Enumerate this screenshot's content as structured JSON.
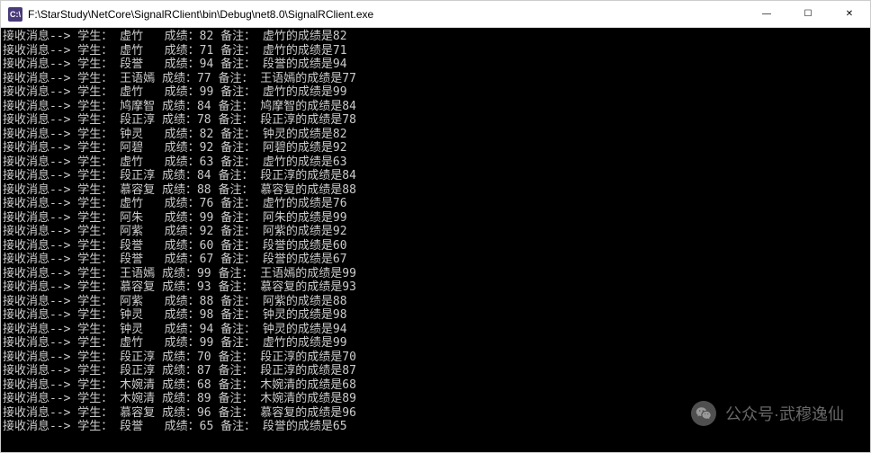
{
  "titlebar": {
    "icon_label": "C:\\",
    "title": "F:\\StarStudy\\NetCore\\SignalRClient\\bin\\Debug\\net8.0\\SignalRClient.exe",
    "minimize": "—",
    "maximize": "☐",
    "close": "✕"
  },
  "console": {
    "prefix": "接收消息--> 学生：",
    "score_label": "成绩：",
    "remark_label": "备注：",
    "remark_suffix": "的成绩是",
    "rows": [
      {
        "name": "虚竹",
        "score": 82
      },
      {
        "name": "虚竹",
        "score": 71
      },
      {
        "name": "段誉",
        "score": 94
      },
      {
        "name": "王语嫣",
        "score": 77
      },
      {
        "name": "虚竹",
        "score": 99
      },
      {
        "name": "鸠摩智",
        "score": 84
      },
      {
        "name": "段正淳",
        "score": 78
      },
      {
        "name": "钟灵",
        "score": 82
      },
      {
        "name": "阿碧",
        "score": 92
      },
      {
        "name": "虚竹",
        "score": 63
      },
      {
        "name": "段正淳",
        "score": 84
      },
      {
        "name": "慕容复",
        "score": 88
      },
      {
        "name": "虚竹",
        "score": 76
      },
      {
        "name": "阿朱",
        "score": 99
      },
      {
        "name": "阿紫",
        "score": 92
      },
      {
        "name": "段誉",
        "score": 60
      },
      {
        "name": "段誉",
        "score": 67
      },
      {
        "name": "王语嫣",
        "score": 99
      },
      {
        "name": "慕容复",
        "score": 93
      },
      {
        "name": "阿紫",
        "score": 88
      },
      {
        "name": "钟灵",
        "score": 98
      },
      {
        "name": "钟灵",
        "score": 94
      },
      {
        "name": "虚竹",
        "score": 99
      },
      {
        "name": "段正淳",
        "score": 70
      },
      {
        "name": "段正淳",
        "score": 87
      },
      {
        "name": "木婉清",
        "score": 68
      },
      {
        "name": "木婉清",
        "score": 89
      },
      {
        "name": "慕容复",
        "score": 96
      },
      {
        "name": "段誉",
        "score": 65
      }
    ]
  },
  "watermark": {
    "text": "公众号·武穆逸仙",
    "icon_name": "wechat-icon"
  }
}
